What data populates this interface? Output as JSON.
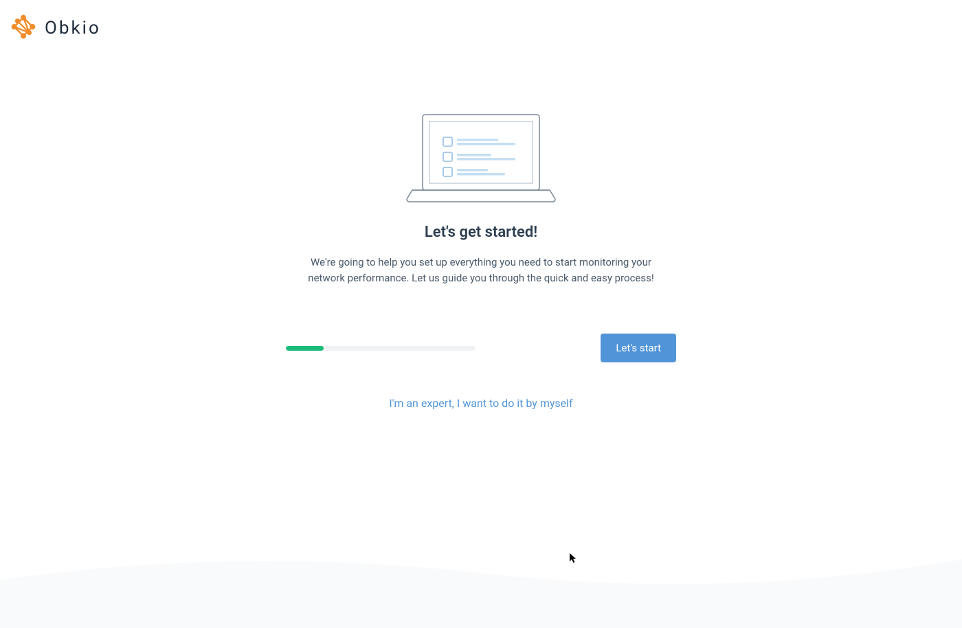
{
  "brand": {
    "name": "Obkio"
  },
  "onboarding": {
    "title": "Let's get started!",
    "description": "We're going to help you set up everything you need to start monitoring your network performance. Let us guide you through the quick and easy process!",
    "start_button": "Let's start",
    "expert_link": "I'm an expert, I want to do it by myself",
    "progress_percent": 20
  }
}
